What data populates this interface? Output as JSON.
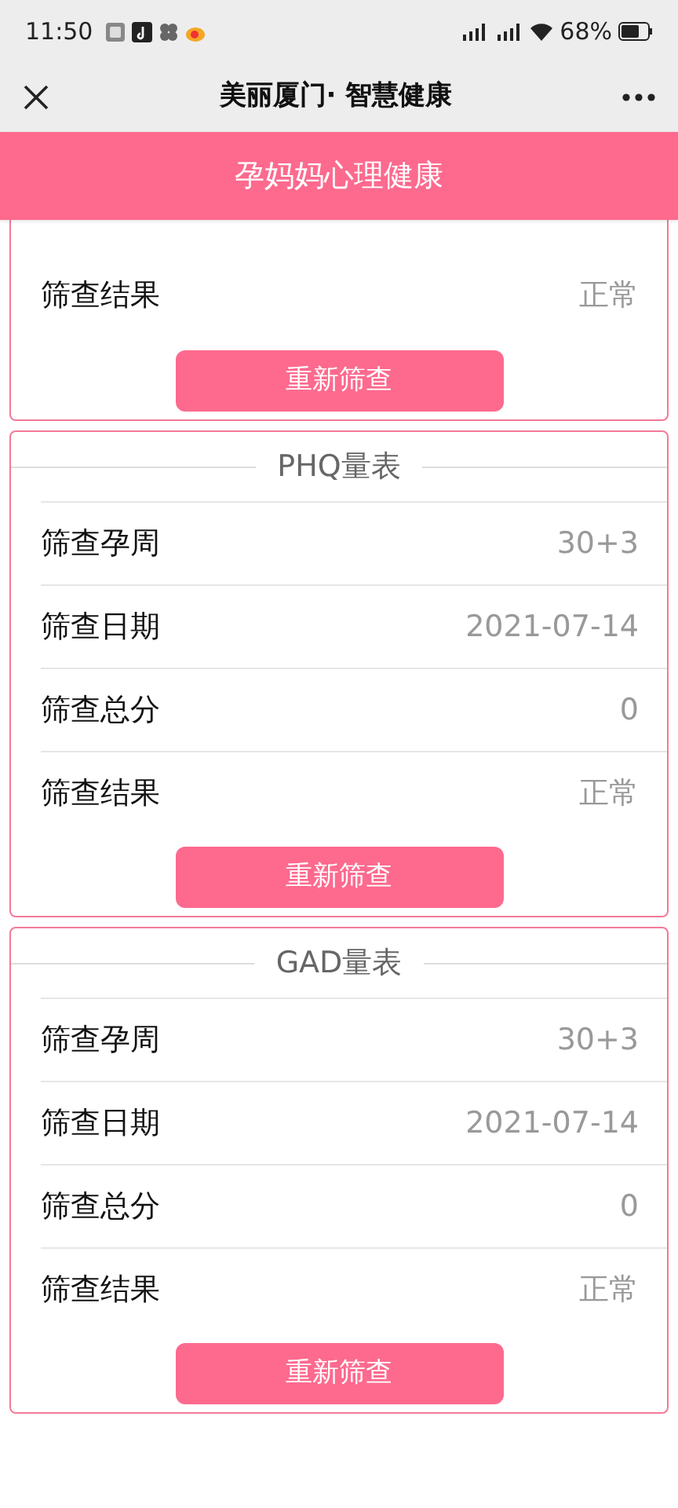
{
  "status_bar": {
    "time": "11:50",
    "battery_text": "68%"
  },
  "nav_bar": {
    "title": "美丽厦门· 智慧健康"
  },
  "header": {
    "title": "孕妈妈心理健康"
  },
  "cards": [
    {
      "rows": [
        {
          "label": "筛查结果",
          "value": "正常"
        }
      ],
      "button": "重新筛查"
    },
    {
      "title": "PHQ量表",
      "rows": [
        {
          "label": "筛查孕周",
          "value": "30+3"
        },
        {
          "label": "筛查日期",
          "value": "2021-07-14"
        },
        {
          "label": "筛查总分",
          "value": "0"
        },
        {
          "label": "筛查结果",
          "value": "正常"
        }
      ],
      "button": "重新筛查"
    },
    {
      "title": "GAD量表",
      "rows": [
        {
          "label": "筛查孕周",
          "value": "30+3"
        },
        {
          "label": "筛查日期",
          "value": "2021-07-14"
        },
        {
          "label": "筛查总分",
          "value": "0"
        },
        {
          "label": "筛查结果",
          "value": "正常"
        }
      ],
      "button": "重新筛查"
    }
  ]
}
